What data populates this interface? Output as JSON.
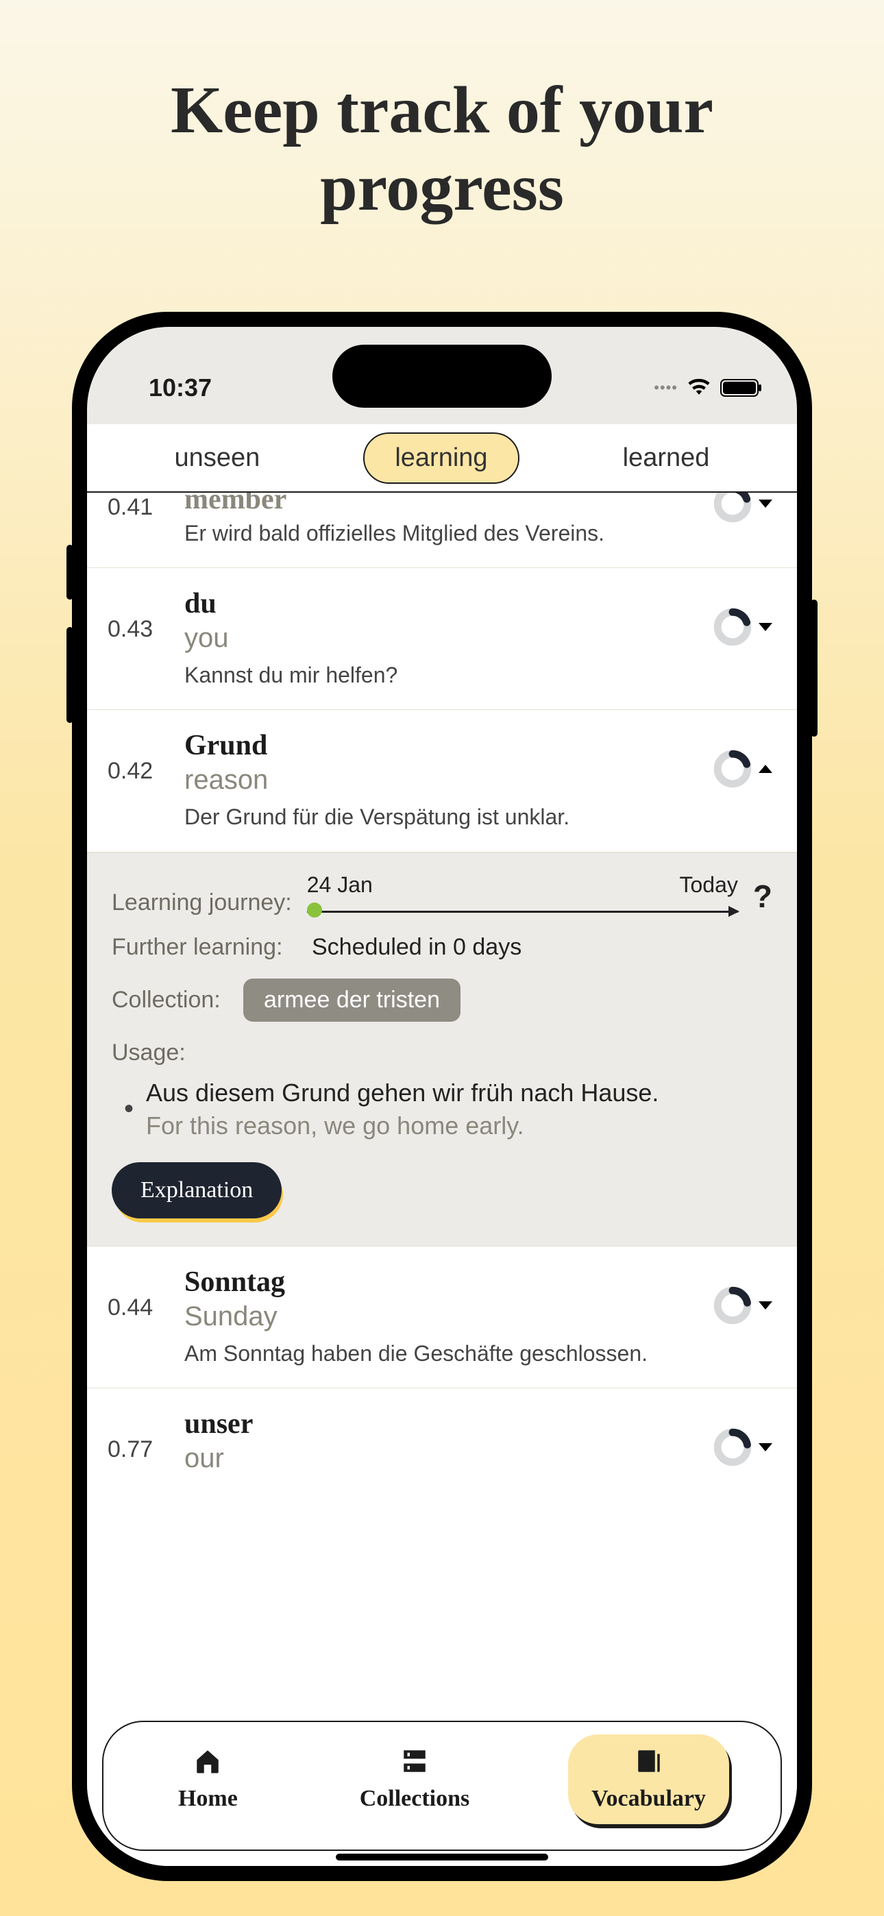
{
  "page": {
    "heading": "Keep track of your progress"
  },
  "status": {
    "time": "10:37"
  },
  "tabs": {
    "items": [
      "unseen",
      "learning",
      "learned"
    ],
    "active_index": 1
  },
  "rows": [
    {
      "score": "0.41",
      "word": "member",
      "translation": "",
      "example": "Er wird bald offizielles Mitglied des Vereins.",
      "progress_pct": 20,
      "expanded": false,
      "word_faded": true
    },
    {
      "score": "0.43",
      "word": "du",
      "translation": "you",
      "example": "Kannst du mir helfen?",
      "progress_pct": 20,
      "expanded": false
    },
    {
      "score": "0.42",
      "word": "Grund",
      "translation": "reason",
      "example": "Der Grund für die Verspätung ist unklar.",
      "progress_pct": 20,
      "expanded": true
    },
    {
      "score": "0.44",
      "word": "Sonntag",
      "translation": "Sunday",
      "example": "Am Sonntag haben die Geschäfte geschlossen.",
      "progress_pct": 25,
      "expanded": false
    },
    {
      "score": "0.77",
      "word": "unser",
      "translation": "our",
      "example": "",
      "progress_pct": 25,
      "expanded": false
    }
  ],
  "detail": {
    "journey_label": "Learning journey:",
    "journey_start": "24 Jan",
    "journey_end": "Today",
    "further_label": "Further learning:",
    "further_value": "Scheduled in 0 days",
    "collection_label": "Collection:",
    "collection_value": "armee der tristen",
    "usage_label": "Usage:",
    "usage_de": "Aus diesem Grund gehen wir früh nach Hause.",
    "usage_en": "For this reason, we go home early.",
    "explanation_btn": "Explanation",
    "help_glyph": "?"
  },
  "nav": {
    "items": [
      {
        "label": "Home",
        "icon": "home"
      },
      {
        "label": "Collections",
        "icon": "tray"
      },
      {
        "label": "Vocabulary",
        "icon": "news"
      }
    ],
    "active_index": 2
  }
}
